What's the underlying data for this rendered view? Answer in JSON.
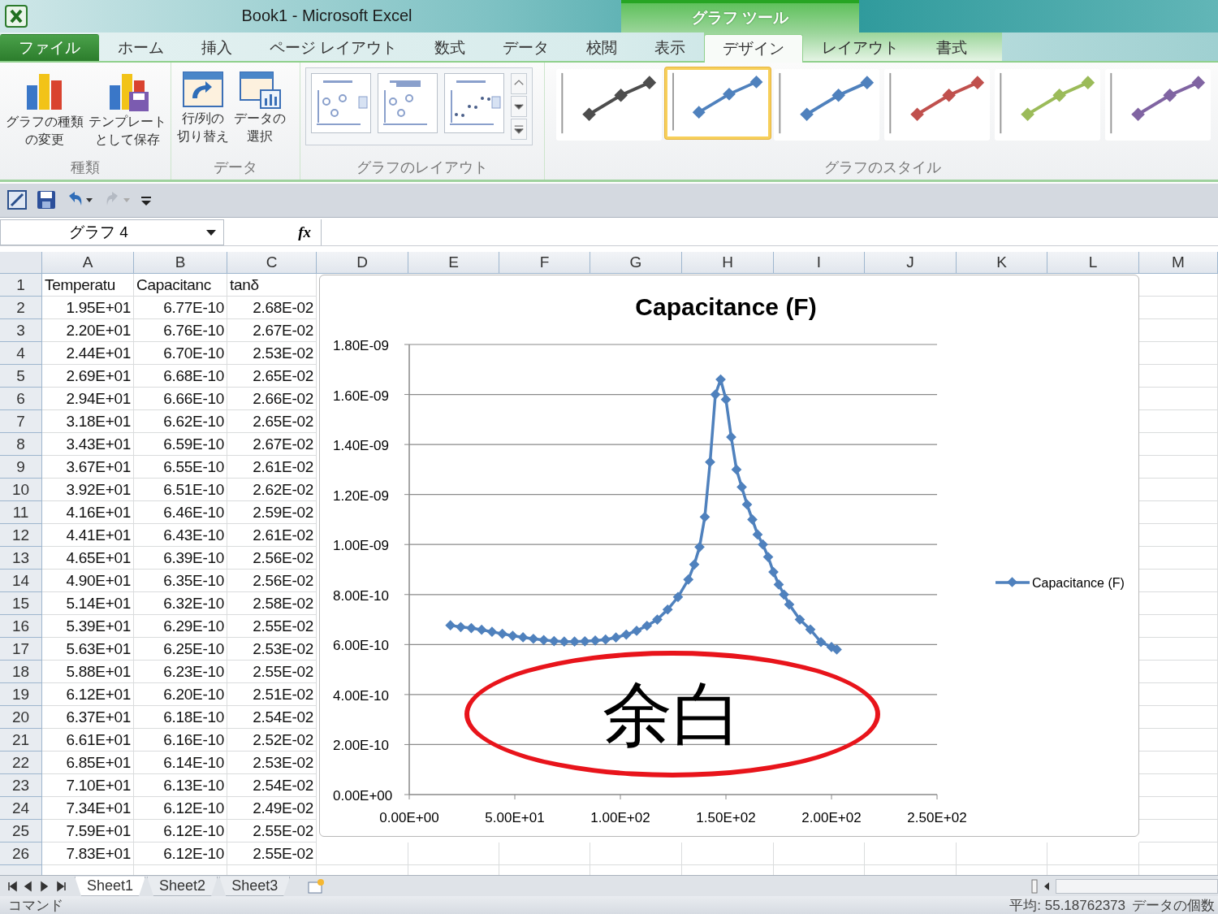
{
  "window": {
    "title": "Book1  -  Microsoft Excel"
  },
  "context_group": "グラフ ツール",
  "tabs": [
    {
      "label": "ファイル",
      "kind": "file",
      "selected": false
    },
    {
      "label": "ホーム",
      "kind": "normal",
      "selected": false
    },
    {
      "label": "挿入",
      "kind": "normal",
      "selected": false
    },
    {
      "label": "ページ レイアウト",
      "kind": "normal",
      "selected": false
    },
    {
      "label": "数式",
      "kind": "normal",
      "selected": false
    },
    {
      "label": "データ",
      "kind": "normal",
      "selected": false
    },
    {
      "label": "校閲",
      "kind": "normal",
      "selected": false
    },
    {
      "label": "表示",
      "kind": "normal",
      "selected": false
    },
    {
      "label": "デザイン",
      "kind": "context",
      "selected": true
    },
    {
      "label": "レイアウト",
      "kind": "context",
      "selected": false
    },
    {
      "label": "書式",
      "kind": "context",
      "selected": false
    }
  ],
  "ribbon": {
    "groups": [
      {
        "label": "種類",
        "kind": "buttons",
        "buttons": [
          {
            "lines": [
              "グラフの種類",
              "の変更"
            ]
          },
          {
            "lines": [
              "テンプレート",
              "として保存"
            ]
          }
        ]
      },
      {
        "label": "データ",
        "kind": "buttons",
        "buttons": [
          {
            "lines": [
              "行/列の",
              "切り替え"
            ]
          },
          {
            "lines": [
              "データの",
              "選択"
            ]
          }
        ]
      },
      {
        "label": "グラフのレイアウト",
        "kind": "layouts"
      },
      {
        "label": "グラフのスタイル",
        "kind": "styles",
        "styles": [
          {
            "color": "#4d4d4d",
            "selected": false
          },
          {
            "color": "#4f81bd",
            "selected": true
          },
          {
            "color": "#4f81bd",
            "selected": false
          },
          {
            "color": "#c0504d",
            "selected": false
          },
          {
            "color": "#9bbb59",
            "selected": false
          },
          {
            "color": "#8064a2",
            "selected": false
          }
        ]
      }
    ]
  },
  "formula_bar": {
    "name_box": "グラフ 4",
    "function_label": "fx"
  },
  "sheet": {
    "columns": [
      "A",
      "B",
      "C",
      "D",
      "E",
      "F",
      "G",
      "H",
      "I",
      "J",
      "K",
      "L",
      "M"
    ],
    "rows": [
      {
        "number": "1",
        "kind": "label",
        "cells": [
          "Temperatu",
          "Capacitanc",
          "tanδ"
        ]
      },
      {
        "number": "2",
        "kind": "value",
        "cells": [
          "1.95E+01",
          "6.77E-10",
          "2.68E-02"
        ]
      },
      {
        "number": "3",
        "kind": "value",
        "cells": [
          "2.20E+01",
          "6.76E-10",
          "2.67E-02"
        ]
      },
      {
        "number": "4",
        "kind": "value",
        "cells": [
          "2.44E+01",
          "6.70E-10",
          "2.53E-02"
        ]
      },
      {
        "number": "5",
        "kind": "value",
        "cells": [
          "2.69E+01",
          "6.68E-10",
          "2.65E-02"
        ]
      },
      {
        "number": "6",
        "kind": "value",
        "cells": [
          "2.94E+01",
          "6.66E-10",
          "2.66E-02"
        ]
      },
      {
        "number": "7",
        "kind": "value",
        "cells": [
          "3.18E+01",
          "6.62E-10",
          "2.65E-02"
        ]
      },
      {
        "number": "8",
        "kind": "value",
        "cells": [
          "3.43E+01",
          "6.59E-10",
          "2.67E-02"
        ]
      },
      {
        "number": "9",
        "kind": "value",
        "cells": [
          "3.67E+01",
          "6.55E-10",
          "2.61E-02"
        ]
      },
      {
        "number": "10",
        "kind": "value",
        "cells": [
          "3.92E+01",
          "6.51E-10",
          "2.62E-02"
        ]
      },
      {
        "number": "11",
        "kind": "value",
        "cells": [
          "4.16E+01",
          "6.46E-10",
          "2.59E-02"
        ]
      },
      {
        "number": "12",
        "kind": "value",
        "cells": [
          "4.41E+01",
          "6.43E-10",
          "2.61E-02"
        ]
      },
      {
        "number": "13",
        "kind": "value",
        "cells": [
          "4.65E+01",
          "6.39E-10",
          "2.56E-02"
        ]
      },
      {
        "number": "14",
        "kind": "value",
        "cells": [
          "4.90E+01",
          "6.35E-10",
          "2.56E-02"
        ]
      },
      {
        "number": "15",
        "kind": "value",
        "cells": [
          "5.14E+01",
          "6.32E-10",
          "2.58E-02"
        ]
      },
      {
        "number": "16",
        "kind": "value",
        "cells": [
          "5.39E+01",
          "6.29E-10",
          "2.55E-02"
        ]
      },
      {
        "number": "17",
        "kind": "value",
        "cells": [
          "5.63E+01",
          "6.25E-10",
          "2.53E-02"
        ]
      },
      {
        "number": "18",
        "kind": "value",
        "cells": [
          "5.88E+01",
          "6.23E-10",
          "2.55E-02"
        ]
      },
      {
        "number": "19",
        "kind": "value",
        "cells": [
          "6.12E+01",
          "6.20E-10",
          "2.51E-02"
        ]
      },
      {
        "number": "20",
        "kind": "value",
        "cells": [
          "6.37E+01",
          "6.18E-10",
          "2.54E-02"
        ]
      },
      {
        "number": "21",
        "kind": "value",
        "cells": [
          "6.61E+01",
          "6.16E-10",
          "2.52E-02"
        ]
      },
      {
        "number": "22",
        "kind": "value",
        "cells": [
          "6.85E+01",
          "6.14E-10",
          "2.53E-02"
        ]
      },
      {
        "number": "23",
        "kind": "value",
        "cells": [
          "7.10E+01",
          "6.13E-10",
          "2.54E-02"
        ]
      },
      {
        "number": "24",
        "kind": "value",
        "cells": [
          "7.34E+01",
          "6.12E-10",
          "2.49E-02"
        ]
      },
      {
        "number": "25",
        "kind": "value",
        "cells": [
          "7.59E+01",
          "6.12E-10",
          "2.55E-02"
        ]
      },
      {
        "number": "26",
        "kind": "value",
        "cells": [
          "7.83E+01",
          "6.12E-10",
          "2.55E-02"
        ]
      }
    ]
  },
  "chart": {
    "chart_data": {
      "type": "line",
      "title": "Capacitance (F)",
      "x": [
        19.5,
        24.4,
        29.4,
        34.3,
        39.2,
        44.1,
        49.0,
        53.9,
        58.8,
        63.7,
        68.6,
        73.4,
        78.3,
        83.2,
        88.1,
        93.0,
        97.9,
        102.8,
        107.7,
        112.6,
        117.5,
        122.4,
        127.3,
        132.2,
        135.0,
        137.5,
        140.0,
        142.5,
        145.0,
        147.5,
        150.0,
        152.5,
        155.0,
        157.5,
        160.0,
        162.5,
        165.0,
        167.5,
        170.0,
        172.5,
        175.0,
        177.5,
        180.0,
        185.0,
        190.0,
        195.0,
        200.0,
        202.5
      ],
      "grid": true,
      "series": [
        {
          "name": "Capacitance (F)",
          "color": "#4f81bd",
          "marker": "diamond",
          "values": [
            6.77e-10,
            6.7e-10,
            6.66e-10,
            6.59e-10,
            6.51e-10,
            6.43e-10,
            6.35e-10,
            6.29e-10,
            6.23e-10,
            6.18e-10,
            6.14e-10,
            6.12e-10,
            6.12e-10,
            6.13e-10,
            6.16e-10,
            6.2e-10,
            6.28e-10,
            6.4e-10,
            6.55e-10,
            6.75e-10,
            7e-10,
            7.4e-10,
            7.9e-10,
            8.6e-10,
            9.2e-10,
            9.9e-10,
            1.11e-09,
            1.33e-09,
            1.6e-09,
            1.66e-09,
            1.58e-09,
            1.43e-09,
            1.3e-09,
            1.23e-09,
            1.16e-09,
            1.1e-09,
            1.04e-09,
            1e-09,
            9.5e-10,
            8.9e-10,
            8.4e-10,
            8e-10,
            7.6e-10,
            7e-10,
            6.6e-10,
            6.1e-10,
            5.9e-10,
            5.8e-10
          ]
        }
      ],
      "xlim": [
        0,
        250
      ],
      "ylim": [
        0,
        1.8e-09
      ],
      "xticks": [
        {
          "value": 0,
          "label": "0.00E+00"
        },
        {
          "value": 50,
          "label": "5.00E+01"
        },
        {
          "value": 100,
          "label": "1.00E+02"
        },
        {
          "value": 150,
          "label": "1.50E+02"
        },
        {
          "value": 200,
          "label": "2.00E+02"
        },
        {
          "value": 250,
          "label": "2.50E+02"
        }
      ],
      "yticks": [
        {
          "value": 0,
          "label": "0.00E+00"
        },
        {
          "value": 2e-10,
          "label": "2.00E-10"
        },
        {
          "value": 4e-10,
          "label": "4.00E-10"
        },
        {
          "value": 6e-10,
          "label": "6.00E-10"
        },
        {
          "value": 8e-10,
          "label": "8.00E-10"
        },
        {
          "value": 1e-09,
          "label": "1.00E-09"
        },
        {
          "value": 1.2e-09,
          "label": "1.20E-09"
        },
        {
          "value": 1.4e-09,
          "label": "1.40E-09"
        },
        {
          "value": 1.6e-09,
          "label": "1.60E-09"
        },
        {
          "value": 1.8e-09,
          "label": "1.80E-09"
        }
      ]
    },
    "callout": {
      "text": "余白",
      "color": "#e8141b"
    }
  },
  "sheet_tabs": [
    {
      "label": "Sheet1",
      "selected": true
    },
    {
      "label": "Sheet2",
      "selected": false
    },
    {
      "label": "Sheet3",
      "selected": false
    }
  ],
  "status_bar": {
    "mode": "コマンド",
    "average": "平均: 55.18762373",
    "count": "データの個数"
  }
}
